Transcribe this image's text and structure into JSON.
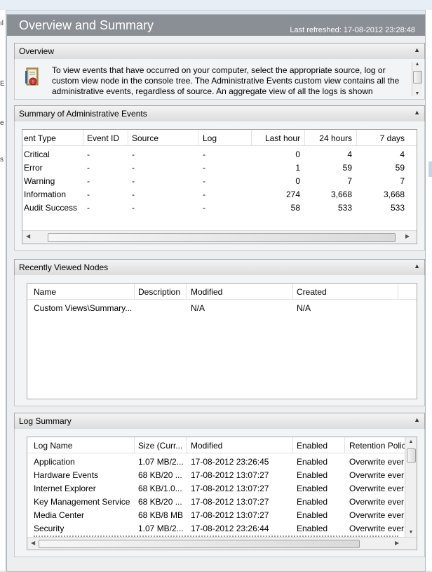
{
  "edge": {
    "left_chars": [
      "ıl",
      "E",
      "e",
      "s"
    ]
  },
  "header": {
    "title": "Overview and Summary",
    "refreshed": "Last refreshed: 17-08-2012 23:28:48"
  },
  "overview": {
    "label": "Overview",
    "text": "To view events that have occurred on your computer, select the appropriate source, log or custom view node in the console tree. The Administrative Events custom view contains all the administrative events, regardless of source. An aggregate view of all the logs is shown"
  },
  "admin": {
    "label": "Summary of Administrative Events",
    "columns": [
      "ent Type",
      "Event ID",
      "Source",
      "Log",
      "Last hour",
      "24 hours",
      "7 days"
    ],
    "rows": [
      [
        "Critical",
        "-",
        "-",
        "-",
        "0",
        "4",
        "4"
      ],
      [
        "Error",
        "-",
        "-",
        "-",
        "1",
        "59",
        "59"
      ],
      [
        "Warning",
        "-",
        "-",
        "-",
        "0",
        "7",
        "7"
      ],
      [
        "Information",
        "-",
        "-",
        "-",
        "274",
        "3,668",
        "3,668"
      ],
      [
        "Audit Success",
        "-",
        "-",
        "-",
        "58",
        "533",
        "533"
      ]
    ]
  },
  "recent": {
    "label": "Recently Viewed Nodes",
    "columns": [
      "Name",
      "Description",
      "Modified",
      "Created"
    ],
    "rows": [
      [
        "Custom Views\\Summary...",
        "",
        "N/A",
        "N/A"
      ]
    ]
  },
  "logs": {
    "label": "Log Summary",
    "columns": [
      "Log Name",
      "Size (Curr...",
      "Modified",
      "Enabled",
      "Retention Polic"
    ],
    "rows": [
      [
        "Application",
        "1.07 MB/2...",
        "17-08-2012 23:26:45",
        "Enabled",
        "Overwrite ever"
      ],
      [
        "Hardware Events",
        "68 KB/20 ...",
        "17-08-2012 13:07:27",
        "Enabled",
        "Overwrite ever"
      ],
      [
        "Internet Explorer",
        "68 KB/1.0...",
        "17-08-2012 13:07:27",
        "Enabled",
        "Overwrite ever"
      ],
      [
        "Key Management Service",
        "68 KB/20 ...",
        "17-08-2012 13:07:27",
        "Enabled",
        "Overwrite ever"
      ],
      [
        "Media Center",
        "68 KB/8 MB",
        "17-08-2012 13:07:27",
        "Enabled",
        "Overwrite ever"
      ],
      [
        "Security",
        "1.07 MB/2...",
        "17-08-2012 23:26:44",
        "Enabled",
        "Overwrite ever"
      ]
    ]
  }
}
